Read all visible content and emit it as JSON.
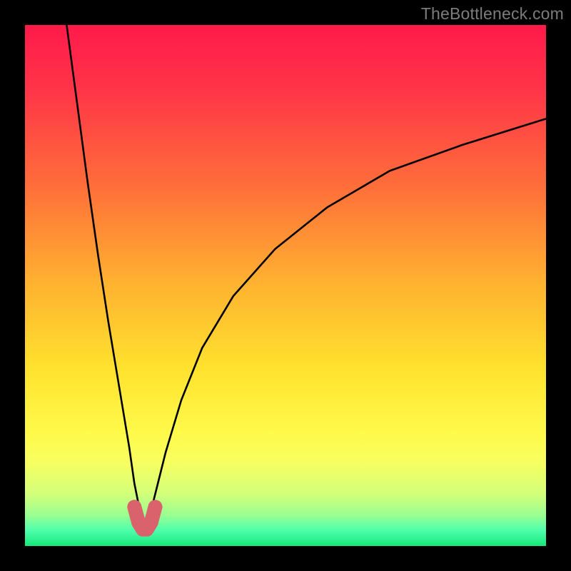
{
  "watermark": "TheBottleneck.com",
  "colors": {
    "frame": "#000000",
    "curve": "#000000",
    "marker": "#d9626c",
    "gradient_stops": [
      {
        "offset": 0.0,
        "color": "#ff1a4a"
      },
      {
        "offset": 0.13,
        "color": "#ff3648"
      },
      {
        "offset": 0.3,
        "color": "#ff6b3a"
      },
      {
        "offset": 0.5,
        "color": "#ffb330"
      },
      {
        "offset": 0.66,
        "color": "#ffe22e"
      },
      {
        "offset": 0.78,
        "color": "#fff94a"
      },
      {
        "offset": 0.84,
        "color": "#f7ff60"
      },
      {
        "offset": 0.9,
        "color": "#d3ff7a"
      },
      {
        "offset": 0.94,
        "color": "#9cff90"
      },
      {
        "offset": 0.97,
        "color": "#4effac"
      },
      {
        "offset": 1.0,
        "color": "#16e87a"
      }
    ]
  },
  "chart_data": {
    "type": "line",
    "title": "",
    "xlabel": "",
    "ylabel": "",
    "xlim": [
      0,
      100
    ],
    "ylim": [
      0,
      100
    ],
    "grid": false,
    "note": "V-shaped bottleneck curve; minimum of curve lies near x≈23, y≈3. Left branch rises to 100% at x≈8; right branch rises toward ~82% at x=100.",
    "series": [
      {
        "name": "bottleneck-curve-left",
        "x": [
          8,
          10,
          12,
          14,
          16,
          18,
          20,
          21,
          22,
          23
        ],
        "y": [
          100,
          85,
          70,
          56,
          43,
          31,
          19,
          12,
          7,
          3
        ]
      },
      {
        "name": "bottleneck-curve-right",
        "x": [
          23,
          24,
          25,
          27,
          30,
          34,
          40,
          48,
          58,
          70,
          84,
          100
        ],
        "y": [
          3,
          6,
          10,
          18,
          28,
          38,
          48,
          57,
          65,
          72,
          77,
          82
        ]
      },
      {
        "name": "minimum-marker",
        "x": [
          21.0,
          21.8,
          22.6,
          23.4,
          24.2,
          25.0
        ],
        "y": [
          7.5,
          4.5,
          3.2,
          3.2,
          4.5,
          7.5
        ]
      }
    ]
  }
}
